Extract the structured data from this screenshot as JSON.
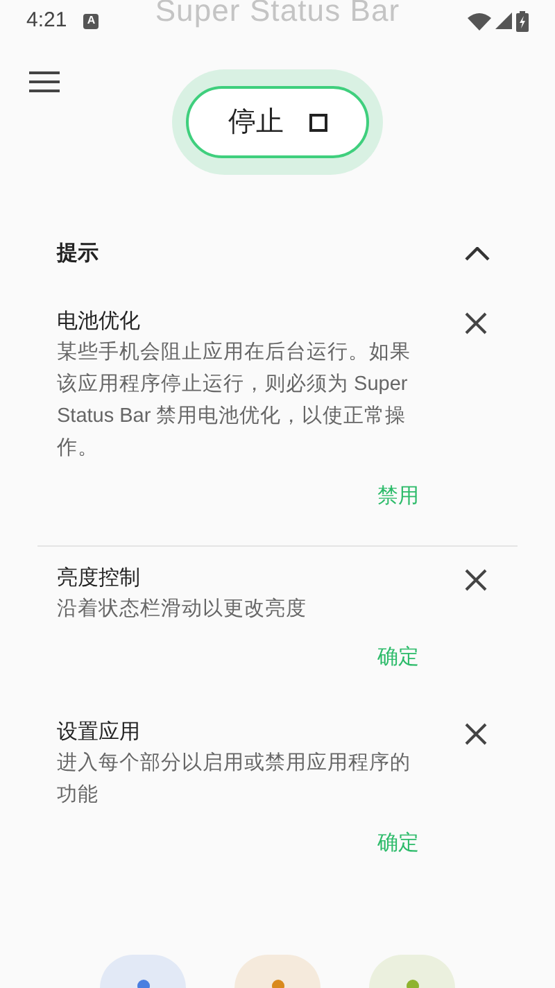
{
  "status_bar": {
    "time": "4:21",
    "notification": "A"
  },
  "app_title": "Super Status Bar",
  "toggle_button": {
    "label": "停止"
  },
  "tips": {
    "title": "提示",
    "expanded": true,
    "items": [
      {
        "title": "电池优化",
        "body": "某些手机会阻止应用在后台运行。如果该应用程序停止运行，则必须为 Super Status Bar 禁用电池优化，以使正常操作。",
        "action": "禁用"
      },
      {
        "title": "亮度控制",
        "body": "沿着状态栏滑动以更改亮度",
        "action": "确定"
      },
      {
        "title": "设置应用",
        "body": "进入每个部分以启用或禁用应用程序的功能",
        "action": "确定"
      }
    ]
  },
  "shortcuts": [
    {
      "color": "#4a7fe0"
    },
    {
      "color": "#d98a1e"
    },
    {
      "color": "#8fb330"
    }
  ]
}
